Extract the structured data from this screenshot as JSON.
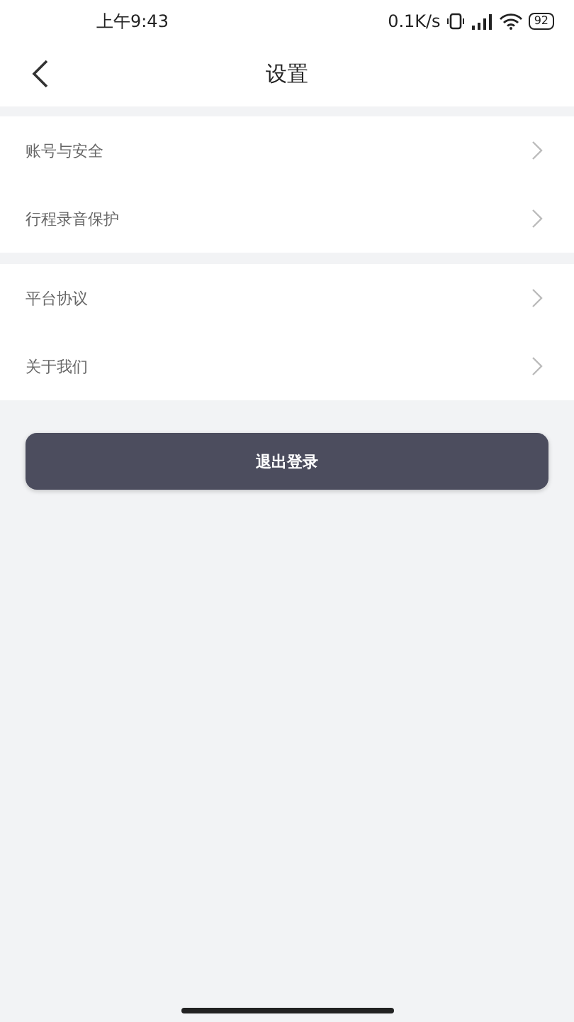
{
  "status_bar": {
    "time": "上午9:43",
    "network_speed": "0.1K/s",
    "battery": "92"
  },
  "header": {
    "title": "设置"
  },
  "groups": [
    {
      "items": [
        {
          "label": "账号与安全"
        },
        {
          "label": "行程录音保护"
        }
      ]
    },
    {
      "items": [
        {
          "label": "平台协议"
        },
        {
          "label": "关于我们"
        }
      ]
    }
  ],
  "logout_button": "退出登录"
}
